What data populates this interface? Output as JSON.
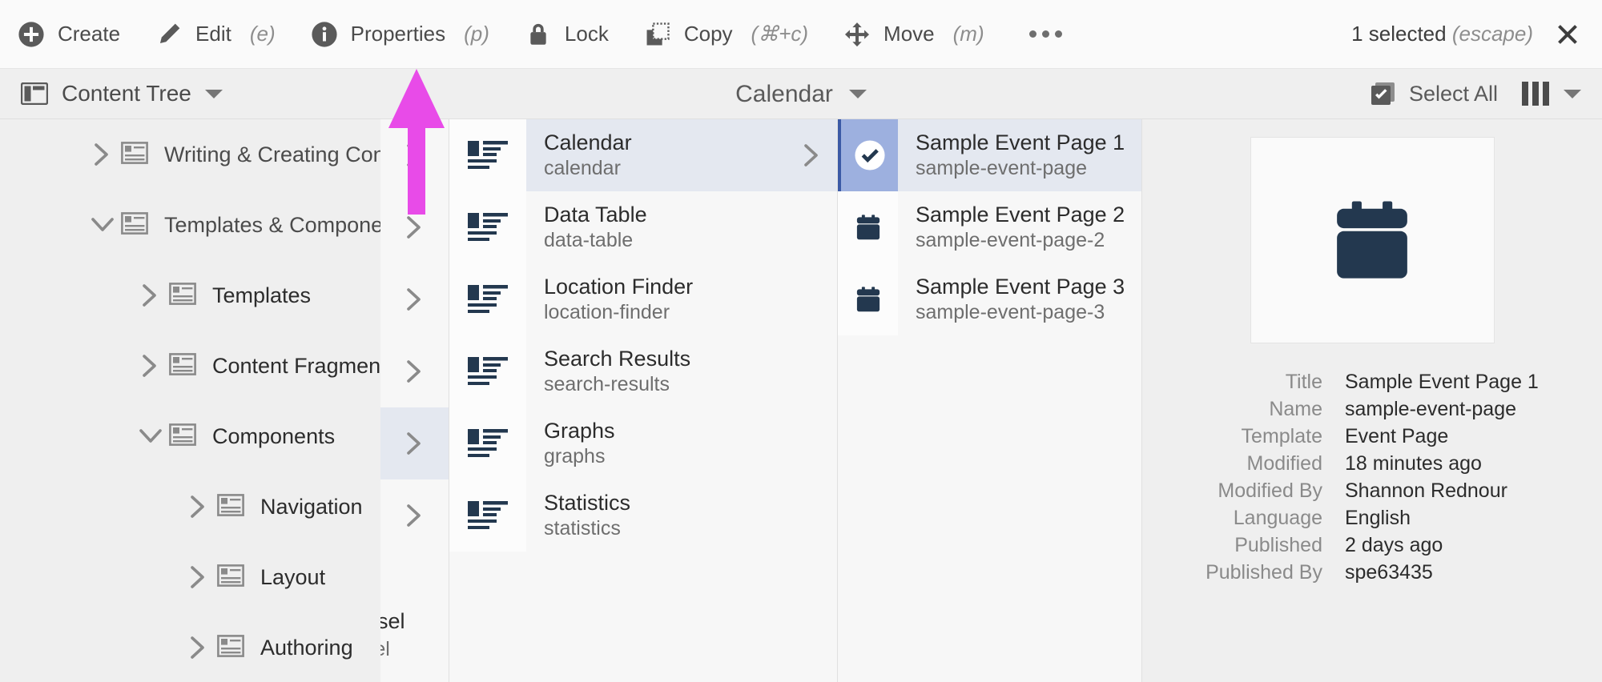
{
  "toolbar": {
    "items": [
      {
        "label": "Create",
        "shortcut": "",
        "icon": "plus-circle-icon"
      },
      {
        "label": "Edit",
        "shortcut": "(e)",
        "icon": "pencil-icon"
      },
      {
        "label": "Properties",
        "shortcut": "(p)",
        "icon": "info-circle-icon"
      },
      {
        "label": "Lock",
        "shortcut": "",
        "icon": "lock-icon"
      },
      {
        "label": "Copy",
        "shortcut": "(⌘+c)",
        "icon": "copy-icon"
      },
      {
        "label": "Move",
        "shortcut": "(m)",
        "icon": "move-icon"
      }
    ],
    "more_label": "More actions",
    "selection_count": "1 selected",
    "selection_escape": "(escape)",
    "close_label": "Close"
  },
  "subheader": {
    "left_label": "Content Tree",
    "title": "Calendar",
    "select_all_label": "Select All",
    "view_label": "Column View"
  },
  "tree": {
    "items": [
      {
        "label": "Writing & Creating Conte",
        "state": "collapsed",
        "indent": 0
      },
      {
        "label": "Templates & Componen",
        "state": "expanded",
        "indent": 0
      },
      {
        "label": "Templates",
        "state": "collapsed",
        "indent": 1
      },
      {
        "label": "Content Fragments",
        "state": "collapsed",
        "indent": 1
      },
      {
        "label": "Components",
        "state": "expanded",
        "indent": 1
      },
      {
        "label": "Navigation",
        "state": "collapsed",
        "indent": 2
      },
      {
        "label": "Layout",
        "state": "collapsed",
        "indent": 2
      },
      {
        "label": "Authoring",
        "state": "collapsed",
        "indent": 2
      }
    ]
  },
  "narrow_column": {
    "rows": [
      {
        "selected": false
      },
      {
        "selected": false
      },
      {
        "selected": false
      },
      {
        "selected": false
      },
      {
        "selected": true
      },
      {
        "selected": false
      }
    ],
    "clipped_title": "ousel",
    "clipped_name": "usel",
    "full_title": "Carousel",
    "full_name": "carousel"
  },
  "components": {
    "rows": [
      {
        "title": "Calendar",
        "name": "calendar",
        "selected": true,
        "has_arrow": true
      },
      {
        "title": "Data Table",
        "name": "data-table",
        "selected": false,
        "has_arrow": false
      },
      {
        "title": "Location Finder",
        "name": "location-finder",
        "selected": false,
        "has_arrow": false
      },
      {
        "title": "Search Results",
        "name": "search-results",
        "selected": false,
        "has_arrow": false
      },
      {
        "title": "Graphs",
        "name": "graphs",
        "selected": false,
        "has_arrow": false
      },
      {
        "title": "Statistics",
        "name": "statistics",
        "selected": false,
        "has_arrow": false
      }
    ]
  },
  "pages": {
    "rows": [
      {
        "title": "Sample Event Page 1",
        "name": "sample-event-page",
        "selected": true,
        "icon": "check-circle-icon"
      },
      {
        "title": "Sample Event Page 2",
        "name": "sample-event-page-2",
        "selected": false,
        "icon": "calendar-icon"
      },
      {
        "title": "Sample Event Page 3",
        "name": "sample-event-page-3",
        "selected": false,
        "icon": "calendar-icon"
      }
    ]
  },
  "preview": {
    "thumbnail_icon": "calendar-icon",
    "fields": [
      {
        "key": "Title",
        "value": "Sample Event Page 1"
      },
      {
        "key": "Name",
        "value": "sample-event-page"
      },
      {
        "key": "Template",
        "value": "Event Page"
      },
      {
        "key": "Modified",
        "value": "18 minutes ago"
      },
      {
        "key": "Modified By",
        "value": "Shannon Rednour"
      },
      {
        "key": "Language",
        "value": "English"
      },
      {
        "key": "Published",
        "value": "2 days ago"
      },
      {
        "key": "Published By",
        "value": "spe63435"
      }
    ]
  },
  "annotation": {
    "type": "arrow",
    "direction": "up",
    "color": "#e84be8",
    "points_at": "Properties"
  },
  "colors": {
    "accent_navy": "#23384f",
    "selection_blue": "#e4e8f0",
    "selection_marker": "#9db0df",
    "annotation": "#e84be8"
  }
}
